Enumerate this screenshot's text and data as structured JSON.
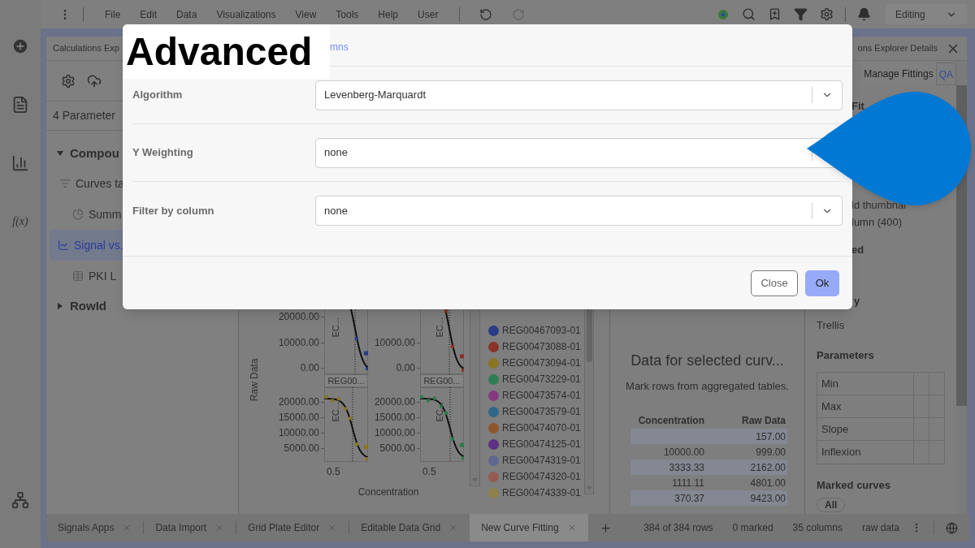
{
  "menu_bar": {
    "items": [
      "File",
      "Edit",
      "Data",
      "Visualizations",
      "View",
      "Tools",
      "Help",
      "User"
    ],
    "mode": "Editing"
  },
  "side_rail": {
    "formula": "f(x)"
  },
  "left_panel": {
    "title": "Calculations Exp",
    "summary": "4 Parameter",
    "tree": [
      {
        "label": "Compou",
        "expanded": true,
        "children": [
          {
            "label": "Curves ta",
            "kind": "sort",
            "selected": false
          },
          {
            "label": "Summ",
            "kind": "pie",
            "selected": false
          },
          {
            "label": "Signal vs.",
            "kind": "line",
            "selected": true
          },
          {
            "label": "PKI L",
            "kind": "table",
            "selected": false
          }
        ]
      },
      {
        "label": "RowId",
        "expanded": false
      }
    ]
  },
  "trellis": {
    "ylabel": "Raw Data",
    "xlabel": "Concentration",
    "panels": [
      {
        "annotation": "EC...",
        "color": "#2a3a85",
        "yticks": [
          "20000.00",
          "10000.00",
          "0.00"
        ]
      },
      {
        "annotation": "EC...",
        "color": "#8a3128",
        "yticks": [
          "10000.00",
          "0.00"
        ]
      },
      {
        "label": "REG00...",
        "annotation": "EC...",
        "color": "#8a7420",
        "yticks": [
          "20000.00",
          "15000.00",
          "10000.00",
          "5000.00"
        ],
        "xtick": "0.5"
      },
      {
        "label": "REG00...",
        "annotation": "EC...",
        "color": "#2a7a4d",
        "yticks": [
          "20000.00",
          "15000.00",
          "10000.00",
          "5000.00"
        ],
        "xtick": "0.5"
      }
    ]
  },
  "legend": [
    {
      "label": "REG00467093-01",
      "color": "#2b3c86"
    },
    {
      "label": "REG00473088-01",
      "color": "#8a3328"
    },
    {
      "label": "REG00473094-01",
      "color": "#8a7624"
    },
    {
      "label": "REG00473229-01",
      "color": "#2e7d52"
    },
    {
      "label": "REG00473574-01",
      "color": "#853a80"
    },
    {
      "label": "REG00473579-01",
      "color": "#306887"
    },
    {
      "label": "REG00474070-01",
      "color": "#8e572b"
    },
    {
      "label": "REG00474125-01",
      "color": "#5d3183"
    },
    {
      "label": "REG00474319-01",
      "color": "#5c6792"
    },
    {
      "label": "REG00474320-01",
      "color": "#955c52"
    },
    {
      "label": "REG00474339-01",
      "color": "#8e814c"
    }
  ],
  "data_panel": {
    "title": "Data for selected curv...",
    "subtitle": "Mark rows from aggregated tables.",
    "columns": [
      "Concentration",
      "Raw Data"
    ],
    "rows": [
      {
        "raw": "157.00"
      },
      {
        "concentration": "10000.00",
        "raw": "999.00"
      },
      {
        "concentration": "3333.33",
        "raw": "2162.00"
      },
      {
        "concentration": "1111.11",
        "raw": "4801.00"
      },
      {
        "concentration": "370.37",
        "raw": "9423.00"
      }
    ]
  },
  "right_panel": {
    "title": "ons Explorer Details",
    "tabs": [
      {
        "label": "Manage Fittings",
        "selected": true
      },
      {
        "label": "QA",
        "selected": false
      }
    ],
    "fragments": [
      {
        "text": "Fit",
        "kind": "heading"
      },
      {
        "text": "ld thumbnai",
        "kind": "text"
      },
      {
        "text": "lumn (400)",
        "kind": "text"
      },
      {
        "text": "ed",
        "kind": "heading"
      },
      {
        "text": "y",
        "kind": "heading"
      }
    ],
    "trellis_value": "Trellis",
    "parameters": {
      "title": "Parameters",
      "rows": [
        "Min",
        "Max",
        "Slope",
        "Inflexion"
      ]
    },
    "marked_curves": {
      "title": "Marked curves",
      "chips": [
        "All"
      ]
    }
  },
  "bottom_bar": {
    "tabs": [
      {
        "label": "Signals Apps",
        "selected": false
      },
      {
        "label": "Data Import",
        "selected": false
      },
      {
        "label": "Grid Plate Editor",
        "selected": false
      },
      {
        "label": "Editable Data Grid",
        "selected": false
      },
      {
        "label": "New Curve Fitting",
        "selected": true
      }
    ],
    "status": [
      "384 of 384 rows",
      "0 marked",
      "35 columns",
      "raw data"
    ]
  },
  "dialog": {
    "title": "Advanced",
    "tab_fragment": "mns",
    "fields": [
      {
        "label": "Algorithm",
        "value": "Levenberg-Marquardt"
      },
      {
        "label": "Y Weighting",
        "value": "none"
      },
      {
        "label": "Filter by column",
        "value": "none"
      }
    ],
    "buttons": [
      {
        "label": "Close",
        "kind": "secondary"
      },
      {
        "label": "Ok",
        "kind": "primary"
      }
    ]
  }
}
